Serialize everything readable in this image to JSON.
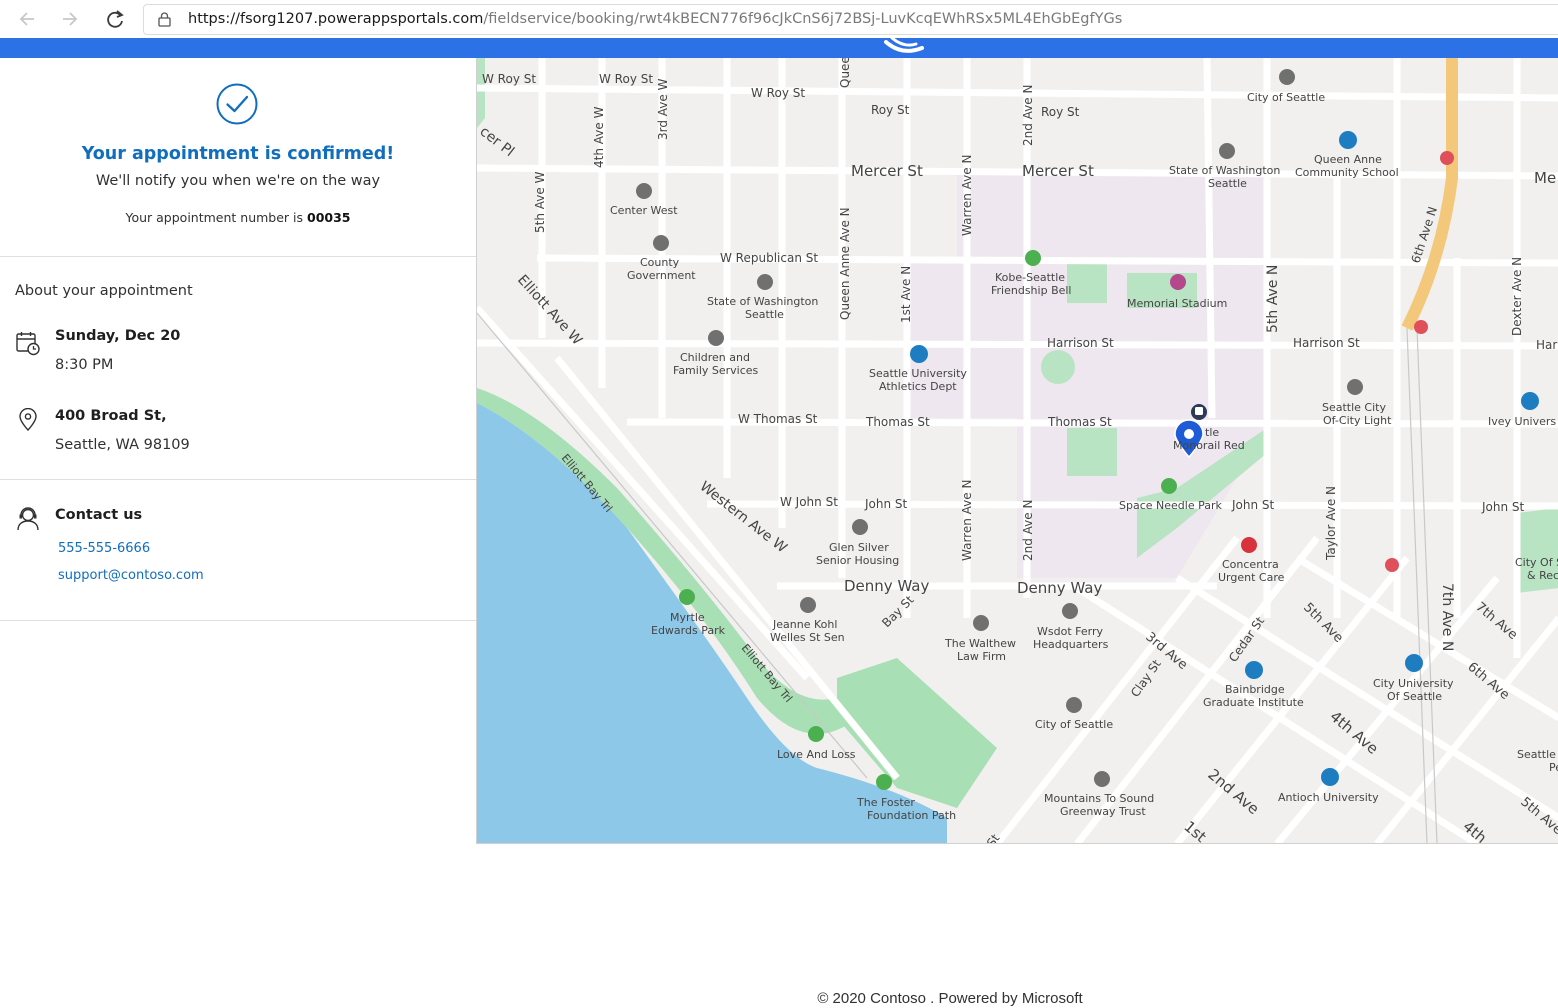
{
  "browser": {
    "back_icon": "back-arrow-icon",
    "forward_icon": "forward-arrow-icon",
    "reload_icon": "reload-icon",
    "url_host": "https://fsorg1207.powerappsportals.com",
    "url_path": "/fieldservice/booking/rwt4kBECN776f96cJkCnS6j72BSj-LuvKcqEWhRSx5ML4EhGbEgfYGs"
  },
  "colors": {
    "brand": "#2c72e6",
    "accent_text": "#106ebe",
    "water": "#8ec8e8",
    "park": "#a9dfb4",
    "campus": "#efe7ef"
  },
  "confirmation": {
    "title": "Your appointment is confirmed!",
    "subtitle": "We'll notify you when we're on the way",
    "number_prefix": "Your appointment number is",
    "number": "00035"
  },
  "about": {
    "heading": "About your appointment",
    "date": "Sunday, Dec 20",
    "time": "8:30 PM",
    "address_line1": "400 Broad St,",
    "address_line2": "Seattle, WA 98109"
  },
  "contact": {
    "heading": "Contact us",
    "phone": "555-555-6666",
    "email": "support@contoso.com"
  },
  "map": {
    "labels": {
      "w_roy_st_1": "W Roy St",
      "w_roy_st_2": "W Roy St",
      "w_roy_st_3": "W Roy St",
      "roy_st": "Roy St",
      "roy_st_2": "Roy St",
      "mercer_st_1": "Mercer St",
      "mercer_st_2": "Mercer St",
      "mercer_edge": "Me",
      "w_republican_st": "W Republican St",
      "harrison_st_1": "Harrison St",
      "harrison_st_2": "Harrison St",
      "harrison_edge": "Har",
      "w_thomas_st": "W Thomas St",
      "thomas_st_1": "Thomas St",
      "thomas_st_2": "Thomas St",
      "w_john_st": "W John St",
      "john_st_1": "John St",
      "john_st_2": "John St",
      "john_st_3": "John St",
      "denny_way_1": "Denny Way",
      "denny_way_2": "Denny Way",
      "elliott_ave_w": "Elliott Ave W",
      "western_ave_w": "Western Ave W",
      "elliott_bay_trl_1": "Elliott Bay Trl",
      "elliott_bay_trl_2": "Elliott Bay Trl",
      "fifth_ave_w": "5th Ave W",
      "fourth_ave_w": "4th Ave W",
      "third_ave_w": "3rd Ave W",
      "queen_anne_ave_n": "Queen Anne Ave N",
      "queen_anne_ave_n_top": "Queen Anne Ave N",
      "warren_ave_n_1": "Warren Ave N",
      "warren_ave_n_2": "Warren Ave N",
      "first_ave_n": "1st Ave N",
      "second_ave_n_1": "2nd Ave N",
      "second_ave_n_2": "2nd Ave N",
      "fifth_ave_n": "5th Ave N",
      "sixth_ave_n": "6th Ave N",
      "dexter_ave_n": "Dexter Ave N",
      "taylor_ave_n": "Taylor Ave N",
      "seventh_ave_n": "7th Ave N",
      "bay_st": "Bay St",
      "third_ave": "3rd Ave",
      "clay_st": "Clay St",
      "cedar_st": "Cedar St",
      "fifth_ave": "5th Ave",
      "seventh_ave": "7th Ave",
      "sixth_ave": "6th Ave",
      "fourth_ave": "4th Ave",
      "second_ave": "2nd Ave",
      "fifth_ave_2": "5th Ave",
      "fourth_ave_2": "4th",
      "first_ave": "1st",
      "cer_pl": "cer Pl",
      "st_frag": "St",
      "center_west": "Center West",
      "county_gov_1": "County",
      "county_gov_2": "Government",
      "wa_state_1": "State of Washington",
      "wa_state_2": "Seattle",
      "wa_state_b1": "State of Washington",
      "wa_state_b2": "Seattle",
      "children_1": "Children and",
      "children_2": "Family Services",
      "city_of_seattle_top": "City of Seattle",
      "queen_anne_cs_1": "Queen Anne",
      "queen_anne_cs_2": "Community School",
      "kobe_1": "Kobe-Seattle",
      "kobe_2": "Friendship Bell",
      "memorial_stadium": "Memorial Stadium",
      "su_athletics_1": "Seattle University",
      "su_athletics_2": "Athletics Dept",
      "monorail": "Monorail Red",
      "seattle_frag": "tle",
      "space_needle_park": "Space Needle Park",
      "seattle_city_light_1": "Seattle City",
      "seattle_city_light_2": "Of-City Light",
      "ivey": "Ivey Univers",
      "glen_silver_1": "Glen Silver",
      "glen_silver_2": "Senior Housing",
      "concentra_1": "Concentra",
      "concentra_2": "Urgent Care",
      "city_seattle_rec_1": "City Of Seattle",
      "city_seattle_rec_2": "& Recreati",
      "myrtle_1": "Myrtle",
      "myrtle_2": "Edwards Park",
      "jeanne_1": "Jeanne Kohl",
      "jeanne_2": "Welles St Sen",
      "walthew_1": "The Walthew",
      "walthew_2": "Law Firm",
      "wsdot_1": "Wsdot Ferry",
      "wsdot_2": "Headquarters",
      "bainbridge_1": "Bainbridge",
      "bainbridge_2": "Graduate Institute",
      "city_u_1": "City University",
      "city_u_2": "Of Seattle",
      "city_of_seattle_bottom": "City of Seattle",
      "love_and_loss": "Love And Loss",
      "foster_1": "The Foster",
      "foster_2": "Foundation Path",
      "mountains_1": "Mountains To Sound",
      "mountains_2": "Greenway Trust",
      "antioch": "Antioch University",
      "seattle_pe_1": "Seattle",
      "seattle_pe_2": "Pe"
    },
    "pin_icon": "location-pin-icon"
  },
  "footer": {
    "text": "© 2020 Contoso . Powered by Microsoft"
  }
}
